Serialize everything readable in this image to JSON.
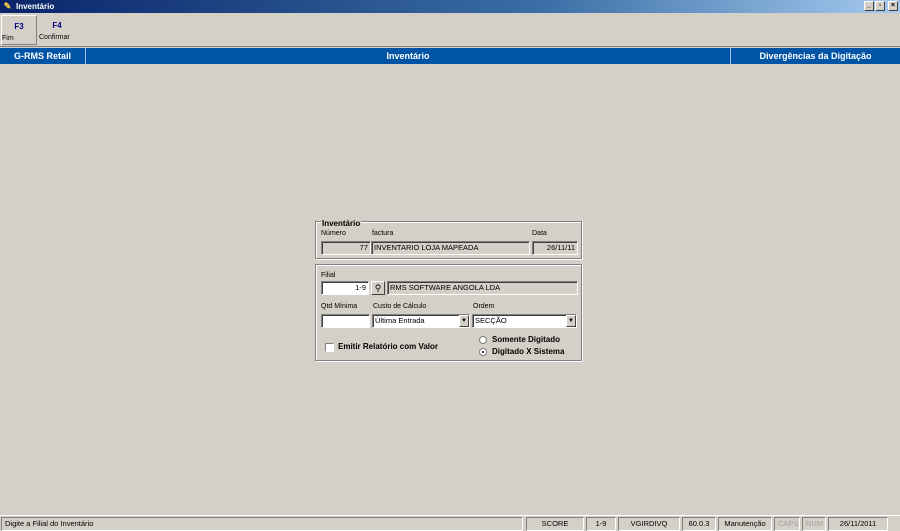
{
  "window": {
    "title": "Inventário",
    "controls": [
      "_",
      "▫",
      "×"
    ]
  },
  "toolbar": {
    "buttons": [
      {
        "key": "F3",
        "label": "Fim"
      },
      {
        "key": "F4",
        "label": "Confirmar"
      }
    ]
  },
  "header": {
    "app": "G-RMS Retail",
    "module": "Inventário",
    "screen": "Divergências da Digitação"
  },
  "inventario": {
    "legend": "Inventário",
    "numero_label": "Número",
    "numero_value": "77",
    "factura_label": "factura",
    "factura_value": "INVENTARIO LOJA MAPEADA",
    "data_label": "Data",
    "data_value": "26/11/11"
  },
  "params": {
    "filial_label": "Filial",
    "filial_value": "1-9",
    "filial_name": "RMS SOFTWARE ANGOLA LDA",
    "qtd_label": "Qtd Mínima",
    "qtd_value": "",
    "custo_label": "Custo de Cálculo",
    "custo_value": "Última Entrada",
    "ordem_label": "Ordem",
    "ordem_value": "SECÇÃO",
    "emitir_label": "Emitir Relatório com Valor",
    "emitir_checked": false,
    "radio_somente": "Somente Digitado",
    "radio_digitado": "Digitado X Sistema",
    "radio_selected": "Digitado X Sistema"
  },
  "status": {
    "message": "Digite a Filial do Inventário",
    "panels": [
      "SCORE",
      "1-9",
      "VGIRDIVQ",
      "60.0.3",
      "Manutenção",
      "CAPS",
      "NUM",
      "26/11/2011"
    ]
  },
  "icons": {
    "app": "app-icon",
    "search": "binoculars-icon"
  }
}
